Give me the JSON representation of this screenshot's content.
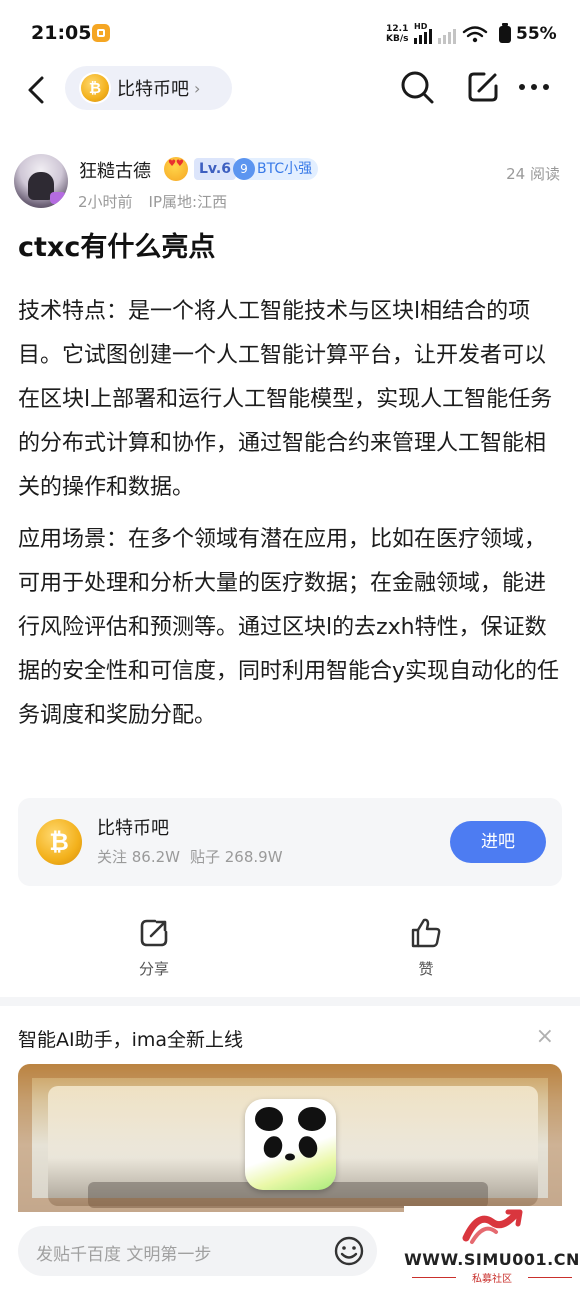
{
  "status_bar": {
    "time": "21:05",
    "net_speed_value": "12.1",
    "net_speed_unit": "KB/s",
    "hd_label": "HD",
    "battery": "55%"
  },
  "nav": {
    "forum_name": "比特币吧",
    "chevron": "›"
  },
  "post": {
    "author": "狂糙古德",
    "level": "Lv.6",
    "badge_number": "9",
    "badge_text": "BTC小强",
    "time_ago": "2小时前",
    "ip_location": "IP属地:江西",
    "reads": "24 阅读",
    "title": "ctxc有什么亮点",
    "paragraphs": [
      "技术特点：是一个将人工智能技术与区块l相结合的项目。它试图创建一个人工智能计算平台，让开发者可以在区块l上部署和运行人工智能模型，实现人工智能任务的分布式计算和协作，通过智能合约来管理人工智能相关的操作和数据。",
      "应用场景：在多个领域有潜在应用，比如在医疗领域，可用于处理和分析大量的医疗数据；在金融领域，能进行风险评估和预测等。通过区块l的去zxh特性，保证数据的安全性和可信度，同时利用智能合y实现自动化的任务调度和奖励分配。"
    ]
  },
  "forum_card": {
    "name": "比特币吧",
    "followers": "关注 86.2W",
    "posts": "贴子 268.9W",
    "join_label": "进吧",
    "coin_symbol": "₿"
  },
  "actions": {
    "share_label": "分享",
    "like_label": "赞"
  },
  "ad": {
    "title": "智能AI助手，ima全新上线",
    "close": "×"
  },
  "composer": {
    "placeholder": "发贴千百度 文明第一步"
  },
  "watermark": {
    "site": "WWW.SIMU001.CN",
    "sub": "私募社区"
  },
  "colors": {
    "accent": "#4d7cf2",
    "level_bg": "#dce5fb",
    "badge_bg": "#e3efff",
    "muted_text": "#9a9a9a"
  }
}
